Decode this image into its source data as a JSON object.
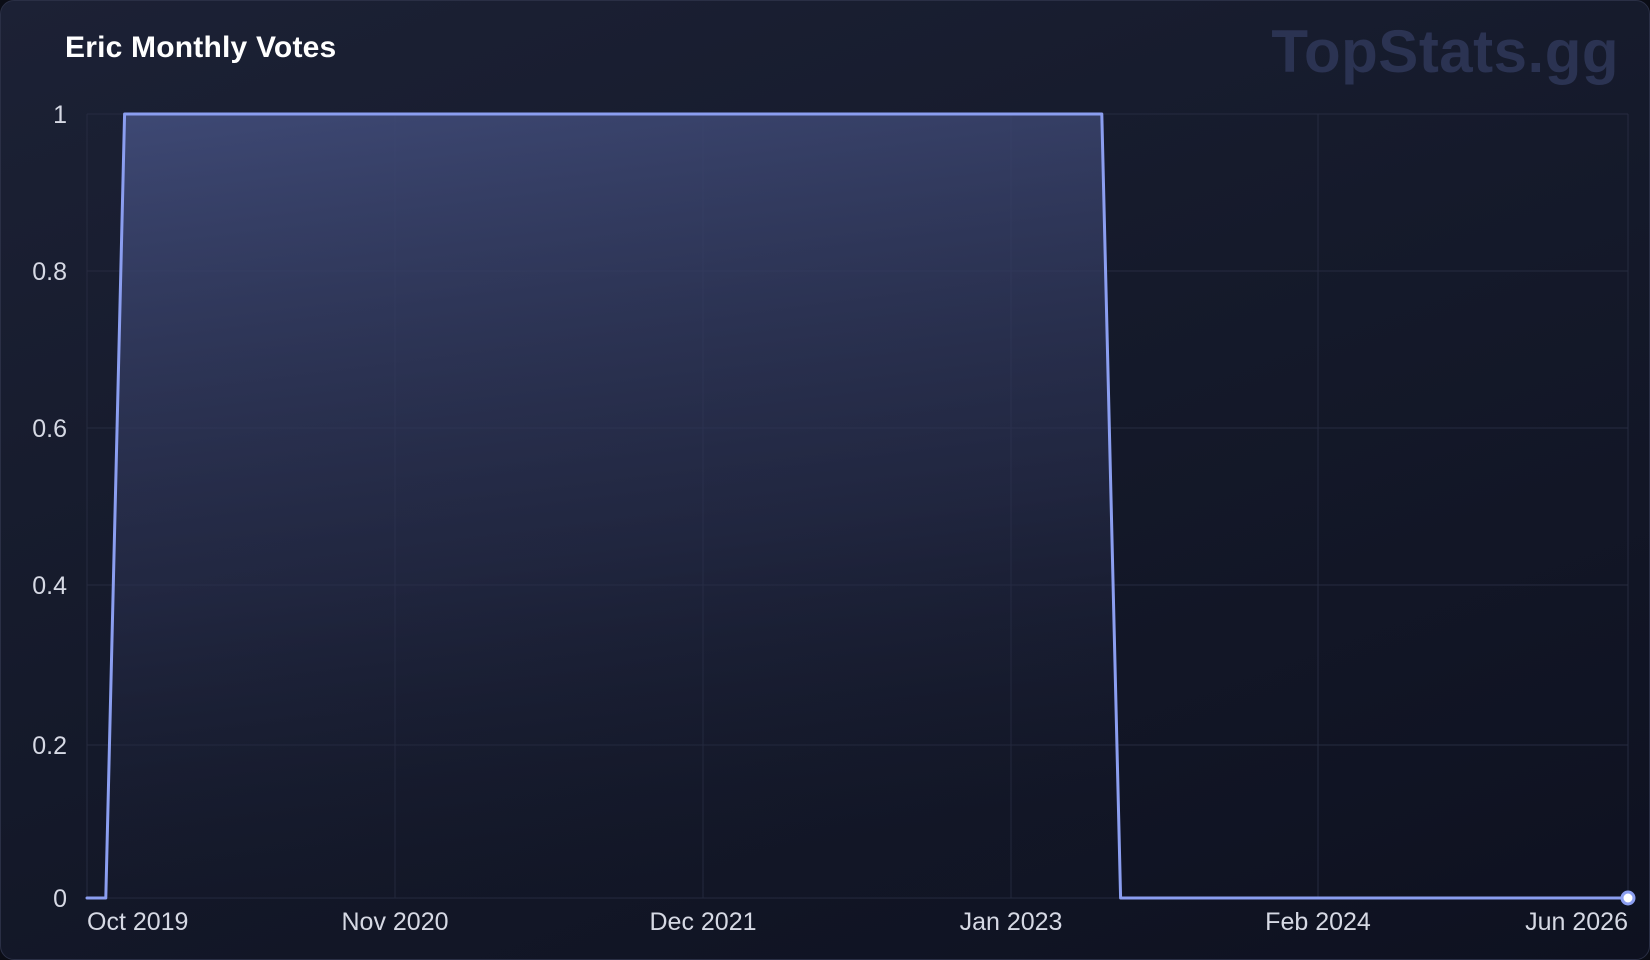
{
  "header": {
    "title": "Eric Monthly Votes",
    "brand": "TopStats.gg"
  },
  "colors": {
    "line": "#8b9ef0",
    "fill_top": "#404b78",
    "grid": "#262b40",
    "tick_text": "#d6d9e4"
  },
  "chart_data": {
    "type": "area",
    "title": "Eric Monthly Votes",
    "xlabel": "",
    "ylabel": "",
    "x_tick_labels": [
      "Oct 2019",
      "Nov 2020",
      "Dec 2021",
      "Jan 2023",
      "Feb 2024",
      "Jun 2026"
    ],
    "y_tick_labels": [
      "0",
      "0.2",
      "0.4",
      "0.6",
      "0.8",
      "1"
    ],
    "ylim": [
      0,
      1
    ],
    "xlim": [
      "2019-08",
      "2026-06"
    ],
    "grid": true,
    "series": [
      {
        "x": [
          "2019-08",
          "2019-09",
          "2019-10",
          "2024-02",
          "2024-03",
          "2026-06"
        ],
        "values": [
          0,
          0,
          1,
          1,
          0,
          0
        ]
      }
    ],
    "last_point_marker": true
  }
}
